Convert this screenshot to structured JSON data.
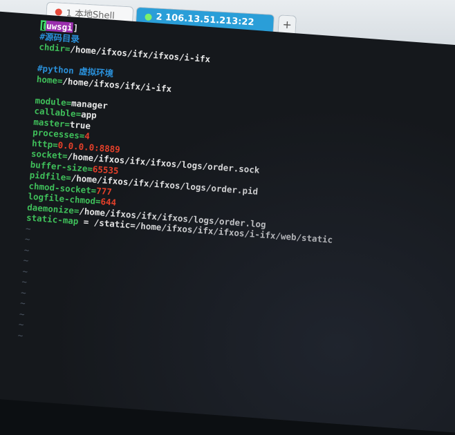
{
  "tabs": [
    {
      "label": "1 本地Shell"
    },
    {
      "label": "2 106.13.51.213:22"
    },
    {
      "label": "+"
    }
  ],
  "editor": {
    "section_open": "[",
    "section_name": "uwsgi",
    "section_close": "]",
    "comment1": "#源码目录",
    "chdir_key": "chdir",
    "chdir_val": "/home/ifxos/ifx/ifxos/i-ifx",
    "comment2": "#python 虚拟环境",
    "home_key": "home",
    "home_val": "/home/ifxos/ifx/i-ifx",
    "module_key": "module",
    "module_val": "manager",
    "callable_key": "callable",
    "callable_val": "app",
    "master_key": "master",
    "master_val": "true",
    "processes_key": "processes",
    "processes_val": "4",
    "http_key": "http",
    "http_val": "0.0.0.0:8889",
    "socket_key": "socket",
    "socket_val": "/home/ifxos/ifx/ifxos/logs/order.sock",
    "buffer_key": "buffer-size",
    "buffer_val": "65535",
    "pidfile_key": "pidfile",
    "pidfile_val": "/home/ifxos/ifx/ifxos/logs/order.pid",
    "chmod_key": "chmod-socket",
    "chmod_val": "777",
    "logchmod_key": "logfile-chmod",
    "logchmod_val": "644",
    "daemonize_key": "daemonize",
    "daemonize_val": "/home/ifxos/ifx/ifxos/logs/order.log",
    "staticmap_key": "static-map",
    "staticmap_val": "/static=/home/ifxos/ifx/ifxos/i-ifx/web/static",
    "eq": "=",
    "eq_spaced": " = ",
    "tilde": "~"
  },
  "colors": {
    "key": "#3fbf5a",
    "number": "#e4402a",
    "comment": "#2a8fd8",
    "section_bg": "#9b2fae",
    "active_tab": "#2a9ed8"
  }
}
